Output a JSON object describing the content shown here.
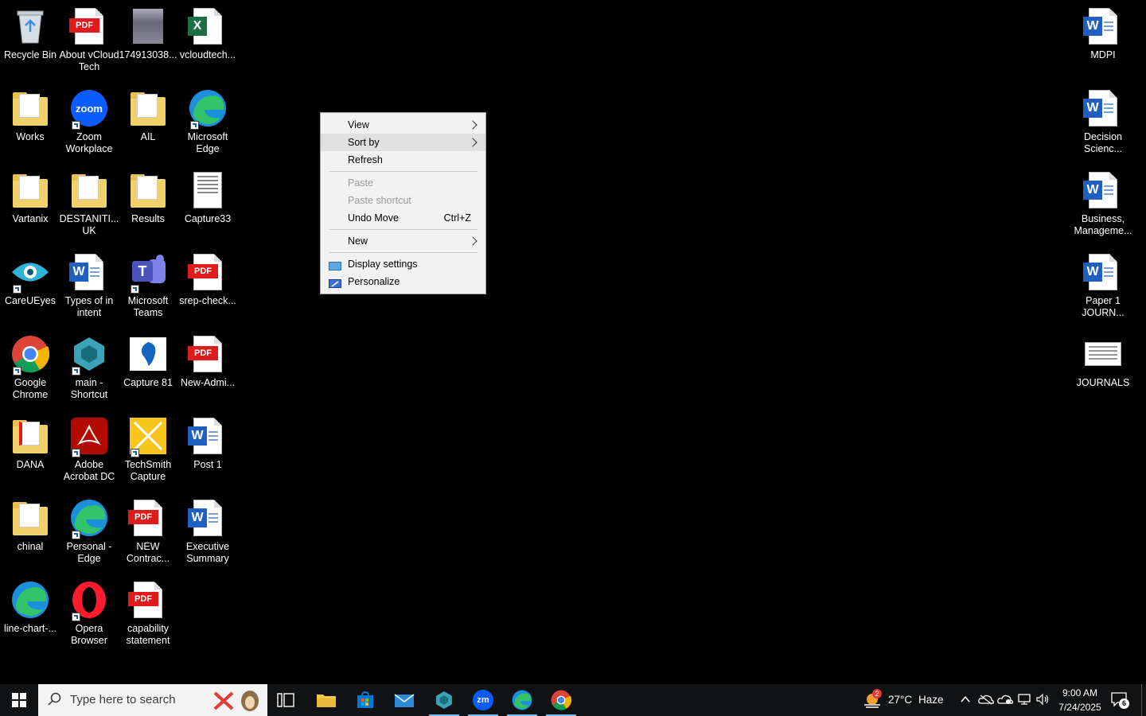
{
  "desktop": {
    "icons": [
      {
        "label": "Recycle Bin"
      },
      {
        "label": "About vCloud Tech"
      },
      {
        "label": "174913038..."
      },
      {
        "label": "vcloudtech..."
      },
      {
        "label": "Works"
      },
      {
        "label": "Zoom Workplace"
      },
      {
        "label": "AIL"
      },
      {
        "label": "Microsoft Edge"
      },
      {
        "label": "Vartanix"
      },
      {
        "label": "DESTANITI... UK"
      },
      {
        "label": "Results"
      },
      {
        "label": "Capture33"
      },
      {
        "label": "CareUEyes"
      },
      {
        "label": "Types of in intent"
      },
      {
        "label": "Microsoft Teams"
      },
      {
        "label": "srep-check..."
      },
      {
        "label": "Google Chrome"
      },
      {
        "label": "main - Shortcut"
      },
      {
        "label": "Capture 81"
      },
      {
        "label": "New-Admi..."
      },
      {
        "label": "DANA"
      },
      {
        "label": "Adobe Acrobat DC"
      },
      {
        "label": "TechSmith Capture"
      },
      {
        "label": "Post 1"
      },
      {
        "label": "chinal"
      },
      {
        "label": "Personal - Edge"
      },
      {
        "label": "NEW Contrac..."
      },
      {
        "label": "Executive Summary"
      },
      {
        "label": "line-chart-..."
      },
      {
        "label": "Opera Browser"
      },
      {
        "label": "capability statement"
      },
      {
        "label": "MDPI"
      },
      {
        "label": "Decision Scienc..."
      },
      {
        "label": "Business, Manageme..."
      },
      {
        "label": "Paper 1 JOURN..."
      },
      {
        "label": "JOURNALS"
      }
    ],
    "badges": {
      "pdf": "PDF",
      "word": "W",
      "excel": "X",
      "zoom": "zoom",
      "teams": "T"
    }
  },
  "context_menu": {
    "items": [
      {
        "label": "View"
      },
      {
        "label": "Sort by"
      },
      {
        "label": "Refresh"
      },
      {
        "label": "Paste"
      },
      {
        "label": "Paste shortcut"
      },
      {
        "label": "Undo Move",
        "shortcut": "Ctrl+Z"
      },
      {
        "label": "New"
      },
      {
        "label": "Display settings"
      },
      {
        "label": "Personalize"
      }
    ]
  },
  "taskbar": {
    "search_placeholder": "Type here to search",
    "weather": {
      "temp": "27°C",
      "condition": "Haze",
      "alert_count": "2"
    },
    "clock": {
      "time": "9:00 AM",
      "date": "7/24/2025"
    },
    "notifications": "6",
    "zoom_label": "zm"
  }
}
